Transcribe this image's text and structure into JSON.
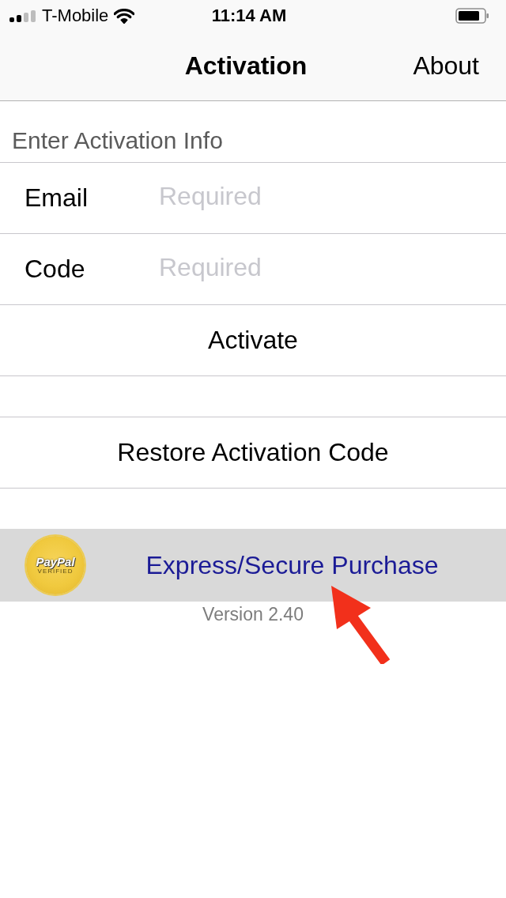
{
  "status_bar": {
    "carrier": "T-Mobile",
    "time": "11:14 AM"
  },
  "nav_bar": {
    "title": "Activation",
    "right_button": "About"
  },
  "section": {
    "header": "Enter Activation Info",
    "fields": [
      {
        "label": "Email",
        "placeholder": "Required"
      },
      {
        "label": "Code",
        "placeholder": "Required"
      }
    ],
    "button": "Activate"
  },
  "restore_button": "Restore Activation Code",
  "purchase_banner": {
    "seal": {
      "brand": "PayPal",
      "caption": "VERIFIED"
    },
    "link": "Express/Secure Purchase"
  },
  "version": "Version 2.40"
}
